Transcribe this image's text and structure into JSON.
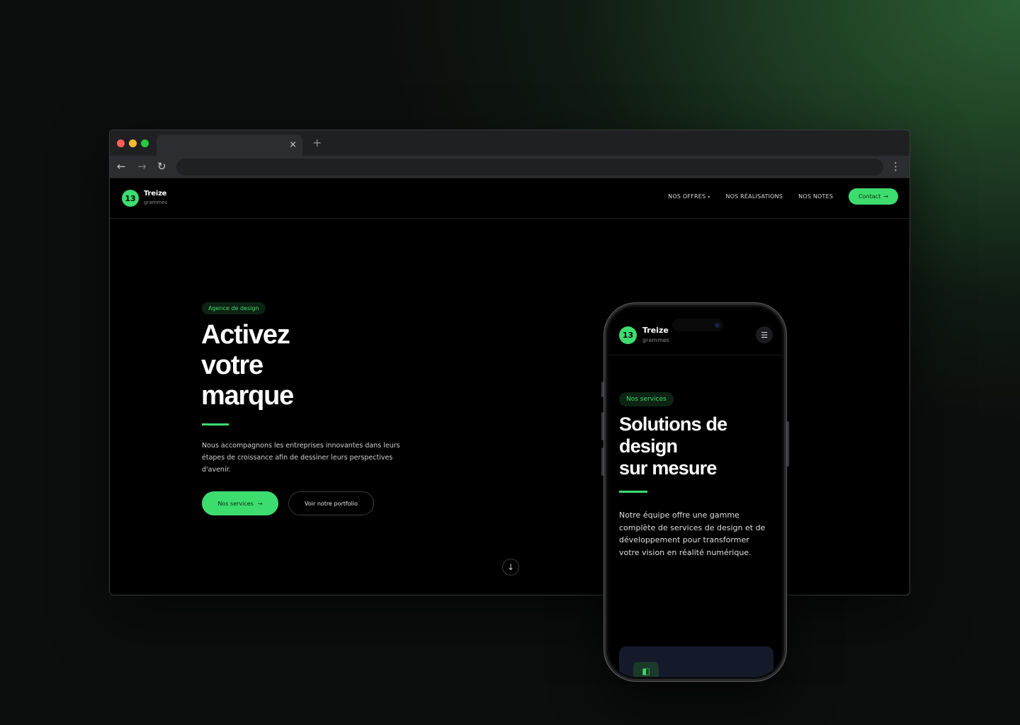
{
  "browser": {
    "tab_close": "×",
    "tab_new": "+",
    "nav_back": "←",
    "nav_forward": "→",
    "reload": "↻",
    "menu": "⋮"
  },
  "site": {
    "logo_number": "13",
    "logo_name": "Treize",
    "logo_sub": "grammes",
    "nav": [
      {
        "label": "NOS OFFRES",
        "has_dropdown": true
      },
      {
        "label": "NOS RÉALISATIONS"
      },
      {
        "label": "NOS NOTES"
      }
    ],
    "nav_caret": "▾",
    "contact_label": "Contact",
    "arrow": "→",
    "hero": {
      "tag": "Agence de design",
      "title_lines": [
        "Activez",
        "votre",
        "marque"
      ],
      "text": "Nous accompagnons les entreprises innovantes dans leurs étapes de croissance afin de dessiner leurs perspectives d'avenir.",
      "primary_label": "Nos services",
      "secondary_label": "Voir notre portfolio"
    },
    "scroll_arrow": "↓"
  },
  "phone": {
    "logo_number": "13",
    "logo_name": "Treize",
    "logo_sub": "grammes",
    "menu_icon": "☰",
    "tag": "Nos services",
    "title_lines": [
      "Solutions de",
      "design",
      "sur mesure"
    ],
    "text": "Notre équipe offre une gamme complète de services de design et de développement pour transformer votre vision en réalité numérique.",
    "card_icon": "◧"
  },
  "colors": {
    "accent": "#3ddc6e",
    "background": "#000000",
    "tag_bg": "#0d2414"
  }
}
